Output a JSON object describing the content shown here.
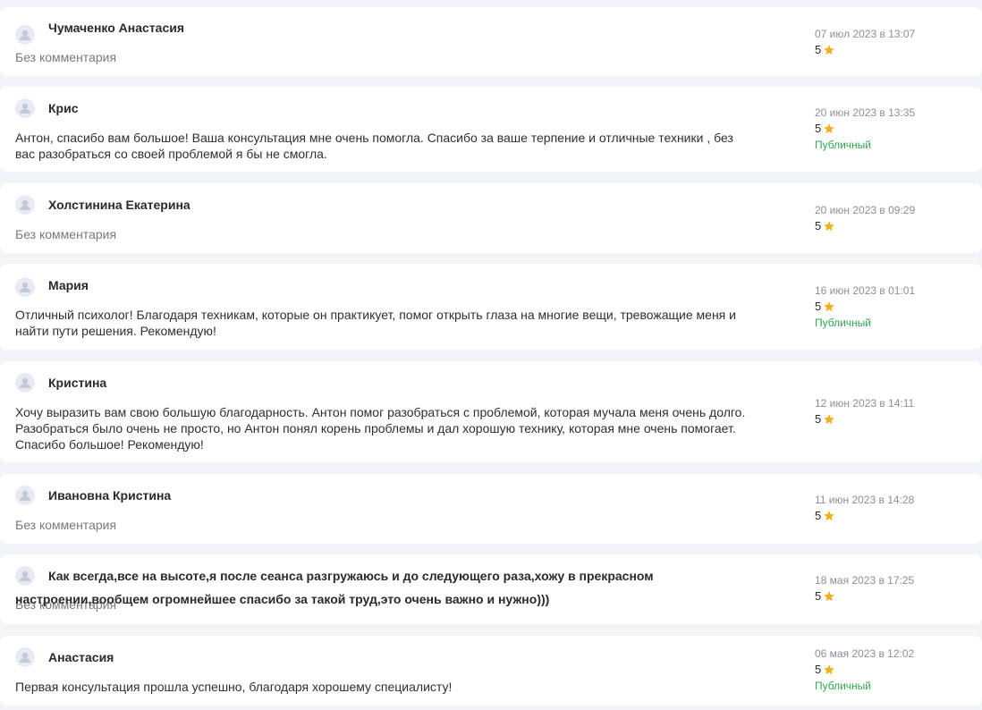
{
  "reviews": [
    {
      "name": "Чумаченко Анастасия",
      "comment": "",
      "no_comment_label": "Без комментария",
      "date": "07 июл 2023 в 13:07",
      "rating": "5",
      "rating_value": 5,
      "status": ""
    },
    {
      "name": "Крис",
      "comment": "Антон, спасибо вам большое! Ваша консультация мне очень помогла. Спасибо за ваше терпение и отличные техники , без вас разобраться со своей проблемой я бы не смогла.",
      "no_comment_label": "",
      "date": "20 июн 2023 в 13:35",
      "rating": "5",
      "rating_value": 5,
      "status": "Публичный"
    },
    {
      "name": "Холстинина Екатерина",
      "comment": "",
      "no_comment_label": "Без комментария",
      "date": "20 июн 2023 в 09:29",
      "rating": "5",
      "rating_value": 5,
      "status": ""
    },
    {
      "name": "Мария",
      "comment": "Отличный психолог! Благодаря техникам, которые он практикует, помог открыть глаза на многие вещи, тревожащие меня и найти пути решения. Рекомендую!",
      "no_comment_label": "",
      "date": "16 июн 2023 в 01:01",
      "rating": "5",
      "rating_value": 5,
      "status": "Публичный"
    },
    {
      "name": "Кристина",
      "comment": "Хочу выразить вам свою большую благодарность. Антон помог разобраться с проблемой, которая мучала меня очень долго. Разобраться было очень не просто, но Антон понял корень проблемы и дал хорошую технику, которая мне очень помогает. Спасибо большое! Рекомендую!",
      "no_comment_label": "",
      "date": "12 июн 2023 в 14:11",
      "rating": "5",
      "rating_value": 5,
      "status": ""
    },
    {
      "name": "Ивановна Кристина",
      "comment": "",
      "no_comment_label": "Без комментария",
      "date": "11 июн 2023 в 14:28",
      "rating": "5",
      "rating_value": 5,
      "status": ""
    },
    {
      "name": "Как всегда,все на высоте,я после сеанса разгружаюсь и до следующего раза,хожу в прекрасном настроении,вообщем огромнейшее спасибо за такой труд,это очень важно и нужно)))",
      "comment": "",
      "no_comment_label": "Без комментария",
      "date": "18 мая 2023 в 17:25",
      "rating": "5",
      "rating_value": 5,
      "status": ""
    },
    {
      "name": "Анастасия",
      "comment": "Первая консультация прошла успешно, благодаря хорошему специалисту!",
      "no_comment_label": "",
      "date": "06 мая 2023 в 12:02",
      "rating": "5",
      "rating_value": 5,
      "status": "Публичный"
    }
  ],
  "colors": {
    "background": "#f3f4f7",
    "card": "#ffffff",
    "star": "#f2b01e",
    "public_status": "#2fa84f",
    "avatar_bg": "#e8ebf3"
  },
  "icons": {
    "avatar": "user-avatar-icon",
    "star": "star-icon"
  }
}
